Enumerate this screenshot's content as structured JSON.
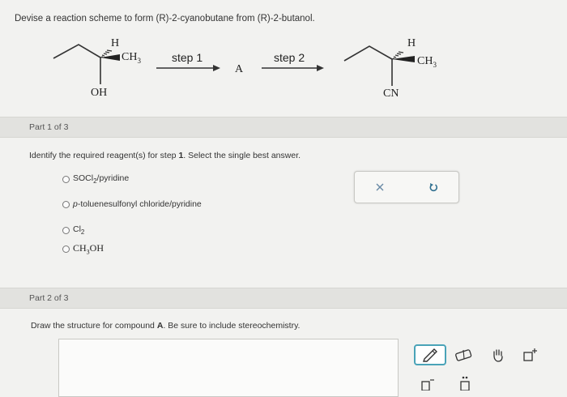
{
  "title": "Devise a reaction scheme to form (R)-2-cyanobutane from (R)-2-butanol.",
  "scheme": {
    "start_h": "H",
    "start_ch3": "CH",
    "start_ch3_sub": "3",
    "start_oh": "OH",
    "step1": "step 1",
    "intermediate": "A",
    "step2": "step 2",
    "end_h": "H",
    "end_ch3": "CH",
    "end_ch3_sub": "3",
    "end_cn": "CN"
  },
  "part1": {
    "label": "Part 1 of 3",
    "question_pre": "Identify the required reagent(s) for step ",
    "question_num": "1",
    "question_post": ". Select the single best answer.",
    "options": [
      {
        "a": "SOCl",
        "sub": "2",
        "b": "/pyridine"
      },
      {
        "a": "p",
        "b": "-toluenesulfonyl chloride/pyridine"
      },
      {
        "a": "Cl",
        "sub": "2",
        "b": ""
      },
      {
        "a": "CH",
        "sub": "3",
        "b": "OH"
      }
    ],
    "clear_icon": "x-icon",
    "reset_icon": "undo-icon"
  },
  "part2": {
    "label": "Part 2 of 3",
    "question_pre": "Draw the structure for compound ",
    "question_bold": "A",
    "question_post": ". Be sure to include stereochemistry."
  },
  "toolbar": {
    "tools": [
      "pencil-icon",
      "eraser-icon",
      "hand-icon",
      "charge-icon",
      "bracket-icon",
      "lone-pair-icon"
    ]
  },
  "colors": {
    "accent": "#4aa3b8",
    "part_bar": "#e2e2df",
    "background": "#f2f2f0"
  }
}
